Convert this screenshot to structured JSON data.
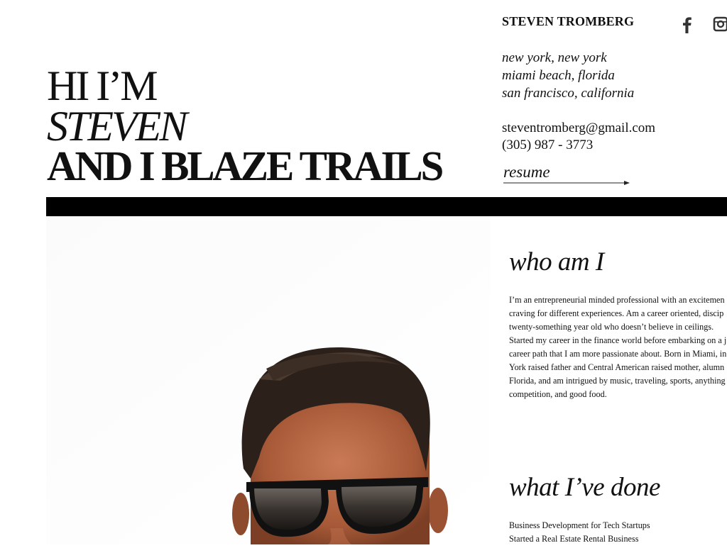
{
  "hero": {
    "line1": "HI I’M",
    "line2": "STEVEN",
    "line3": "AND I BLAZE TRAILS"
  },
  "brand": {
    "name": "STEVEN TROMBERG"
  },
  "social": [
    {
      "icon": "facebook-icon"
    },
    {
      "icon": "instagram-icon"
    }
  ],
  "contact": {
    "locations": [
      "new york, new york",
      "miami beach, florida",
      "san francisco, california"
    ],
    "email": "steventromberg@gmail.com",
    "phone": "(305) 987 - 3773",
    "resume_label": "resume"
  },
  "about": {
    "title": "who am I",
    "lines": [
      "I’m an entrepreneurial minded professional with an excitemen",
      "craving for different experiences.  Am a career oriented, discip",
      "twenty-something year old who doesn’t believe in ceilings.",
      "Started my career in the finance world before embarking on a j",
      "career path that I am more passionate about. Born in Miami, in",
      "York raised father and Central American raised mother, alumn",
      "Florida, and am intrigued by music, traveling, sports, anything",
      "competition, and good food."
    ]
  },
  "experience": {
    "title": "what I’ve done",
    "items": [
      "Business Development for Tech Startups",
      "Started a Real Estate Rental Business"
    ]
  },
  "colors": {
    "text": "#111111",
    "rule": "#000000",
    "background": "#ffffff"
  }
}
